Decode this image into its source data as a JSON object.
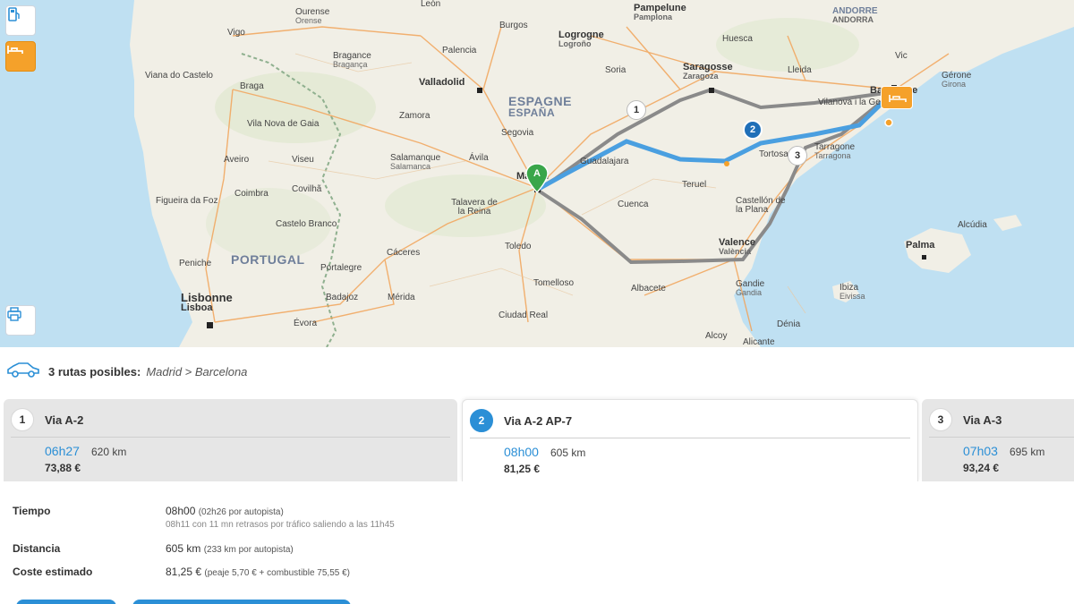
{
  "map": {
    "countries": [
      {
        "name": "ESPAGNE",
        "native": "ESPAÑA"
      },
      {
        "name": "PORTUGAL",
        "native": ""
      },
      {
        "name": "ANDORRE",
        "native": "ANDORRA"
      }
    ],
    "cities": [
      {
        "name": "Pampelune",
        "native": "Pamplona"
      },
      {
        "name": "Logrogne",
        "native": "Logroño"
      },
      {
        "name": "Burgos",
        "native": ""
      },
      {
        "name": "Palencia",
        "native": ""
      },
      {
        "name": "Valladolid",
        "native": ""
      },
      {
        "name": "Saragosse",
        "native": "Zaragoza"
      },
      {
        "name": "Huesca",
        "native": ""
      },
      {
        "name": "Lleida",
        "native": ""
      },
      {
        "name": "Vic",
        "native": ""
      },
      {
        "name": "Gérone",
        "native": "Girona"
      },
      {
        "name": "Vilanova i la Geltrú",
        "native": ""
      },
      {
        "name": "Tarragone",
        "native": "Tarragona"
      },
      {
        "name": "Tortosa",
        "native": ""
      },
      {
        "name": "Teruel",
        "native": ""
      },
      {
        "name": "Castellón de la Plana",
        "native": ""
      },
      {
        "name": "Valence",
        "native": "València"
      },
      {
        "name": "Gandie",
        "native": "Gandia"
      },
      {
        "name": "Dénia",
        "native": ""
      },
      {
        "name": "Alcoy",
        "native": ""
      },
      {
        "name": "Alicante",
        "native": ""
      },
      {
        "name": "Albacete",
        "native": ""
      },
      {
        "name": "Cuenca",
        "native": ""
      },
      {
        "name": "Guadalajara",
        "native": ""
      },
      {
        "name": "Madrid",
        "native": ""
      },
      {
        "name": "Toledo",
        "native": ""
      },
      {
        "name": "Talavera de la Reina",
        "native": ""
      },
      {
        "name": "Ávila",
        "native": ""
      },
      {
        "name": "Segovia",
        "native": ""
      },
      {
        "name": "Salamanque",
        "native": "Salamanca"
      },
      {
        "name": "Zamora",
        "native": ""
      },
      {
        "name": "Soria",
        "native": ""
      },
      {
        "name": "Ourense",
        "native": "Orense"
      },
      {
        "name": "Vigo",
        "native": ""
      },
      {
        "name": "Bragance",
        "native": "Bragança"
      },
      {
        "name": "Braga",
        "native": ""
      },
      {
        "name": "Viana do Castelo",
        "native": ""
      },
      {
        "name": "Vila Nova de Gaia",
        "native": ""
      },
      {
        "name": "Aveiro",
        "native": ""
      },
      {
        "name": "Viseu",
        "native": ""
      },
      {
        "name": "Coimbra",
        "native": ""
      },
      {
        "name": "Covilhã",
        "native": ""
      },
      {
        "name": "Figueira da Foz",
        "native": ""
      },
      {
        "name": "Castelo Branco",
        "native": ""
      },
      {
        "name": "Cáceres",
        "native": ""
      },
      {
        "name": "Portalegre",
        "native": ""
      },
      {
        "name": "Peniche",
        "native": ""
      },
      {
        "name": "Badajoz",
        "native": ""
      },
      {
        "name": "Mérida",
        "native": ""
      },
      {
        "name": "Lisbonne",
        "native": "Lisboa"
      },
      {
        "name": "Évora",
        "native": ""
      },
      {
        "name": "Ciudad Real",
        "native": ""
      },
      {
        "name": "Tomelloso",
        "native": ""
      },
      {
        "name": "Alcúdia",
        "native": ""
      },
      {
        "name": "Palma",
        "native": ""
      },
      {
        "name": "Ibiza",
        "native": "Eivissa"
      },
      {
        "name": "León",
        "native": ""
      },
      {
        "name": "Barcelone",
        "native": ""
      }
    ],
    "markers": {
      "start": "A",
      "route_numbers": [
        "1",
        "2",
        "3"
      ]
    },
    "colors": {
      "sea": "#bfe0f2",
      "land": "#f1efe6",
      "route_selected": "#4a9fe0",
      "route_alt": "#8a8a8a",
      "start_marker": "#3aa64a",
      "end_marker": "#f5a12a"
    },
    "buttons": [
      {
        "icon": "fuel-station-icon"
      },
      {
        "icon": "hotel-bed-icon"
      },
      {
        "icon": "print-icon"
      }
    ]
  },
  "summary": {
    "icon": "car-icon",
    "count_text": "3 rutas posibles:",
    "origin_destination": "Madrid > Barcelona"
  },
  "routes": [
    {
      "number": "1",
      "name": "Via A-2",
      "time": "06h27",
      "distance": "620 km",
      "cost": "73,88 €",
      "selected": false
    },
    {
      "number": "2",
      "name": "Via A-2 AP-7",
      "time": "08h00",
      "distance": "605 km",
      "cost": "81,25 €",
      "selected": true
    },
    {
      "number": "3",
      "name": "Via A-3",
      "time": "07h03",
      "distance": "695 km",
      "cost": "93,24 €",
      "selected": false
    }
  ],
  "details": {
    "time_label": "Tiempo",
    "time_value": "08h00",
    "time_note": "(02h26 por autopista)",
    "time_sub": "08h11 con 11 mn retrasos por tráfico saliendo a las 11h45",
    "distance_label": "Distancia",
    "distance_value": "605 km",
    "distance_note": "(233 km por autopista)",
    "cost_label": "Coste estimado",
    "cost_value": "81,25 €",
    "cost_note": "(peaje 5,70 € + combustible 75,55 €)"
  }
}
